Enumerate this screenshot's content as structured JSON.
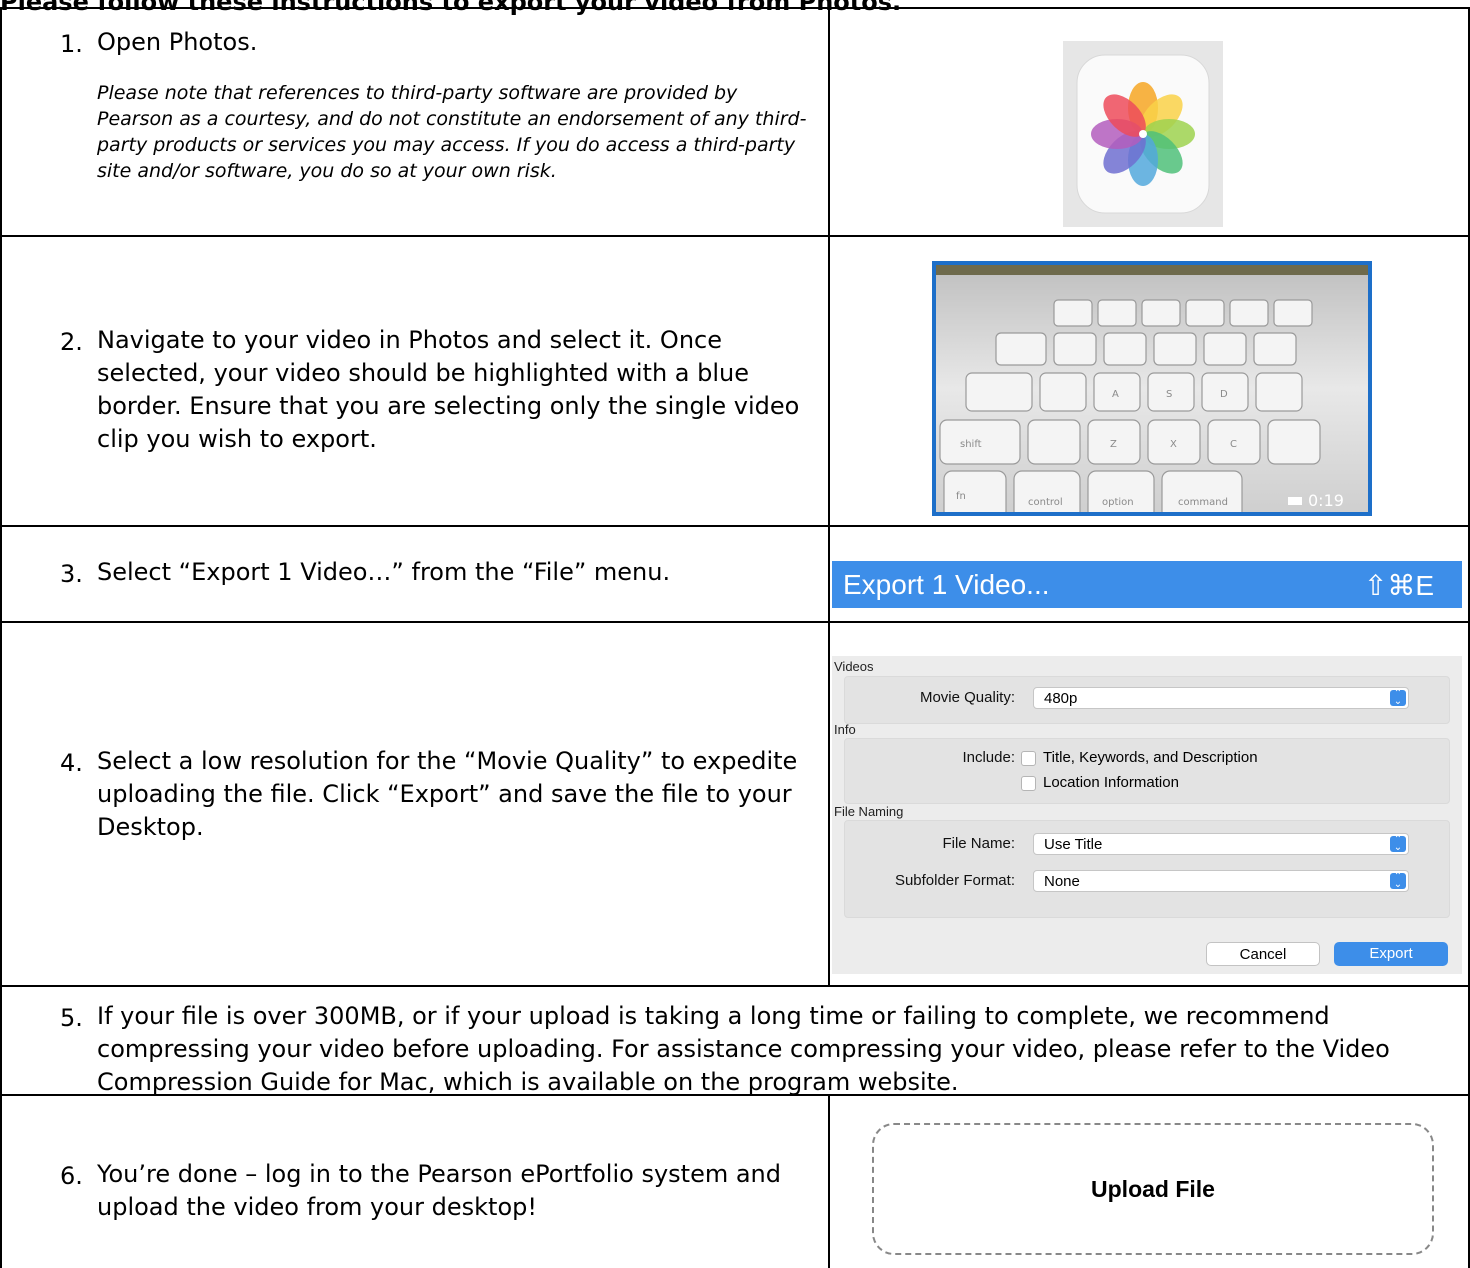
{
  "heading": "Please follow these instructions to export your video from Photos.",
  "steps": [
    {
      "num": "1.",
      "text": "Open Photos.",
      "note": "Please note that references to third-party software are provided by Pearson as a courtesy, and do not constitute an endorsement of any third-party products or services you may access. If you do access a third-party site and/or software, you do so at your own risk."
    },
    {
      "num": "2.",
      "text": "Navigate to your video in Photos and select it. Once selected, your video should be highlighted with a blue border. Ensure that you are selecting only the single video clip you wish to export."
    },
    {
      "num": "3.",
      "text": "Select “Export 1 Video…” from the “File” menu."
    },
    {
      "num": "4.",
      "text": "Select a low resolution for the “Movie Quality” to expedite uploading the file. Click “Export” and save the file to your Desktop."
    },
    {
      "num": "5.",
      "text": "If your file is over 300MB, or if your upload is taking a long time or failing to complete, we recommend compressing your video before uploading. For assistance compressing your video, please refer to the Video Compression Guide for Mac, which is available on the program website."
    },
    {
      "num": "6.",
      "text": "You’re done – log in to the Pearson ePortfolio system and upload the video from your desktop!"
    }
  ],
  "thumb": {
    "duration": "0:19",
    "keys": [
      "fn",
      "control",
      "option",
      "command",
      "shift",
      "Z",
      "X",
      "C",
      "A",
      "S",
      "D"
    ]
  },
  "menu": {
    "label": "Export 1 Video...",
    "shortcut": "⇧⌘E",
    "color": "#3d8ee9"
  },
  "dialog": {
    "videos_section": "Videos",
    "movie_quality_label": "Movie Quality:",
    "movie_quality_value": "480p",
    "info_section": "Info",
    "include_label": "Include:",
    "opt1": "Title, Keywords, and Description",
    "opt2": "Location Information",
    "naming_section": "File Naming",
    "file_name_label": "File Name:",
    "file_name_value": "Use Title",
    "subfolder_label": "Subfolder Format:",
    "subfolder_value": "None",
    "cancel": "Cancel",
    "export": "Export"
  },
  "upload": {
    "label": "Upload File"
  }
}
